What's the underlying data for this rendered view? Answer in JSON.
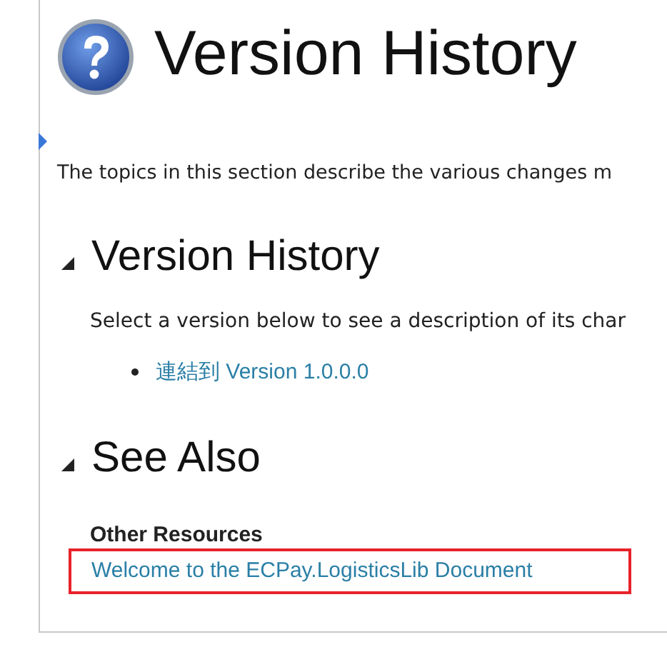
{
  "page": {
    "title": "Version History",
    "intro": "The topics in this section describe the various changes m",
    "sections": [
      {
        "heading": "Version History",
        "expanded": true,
        "text": "Select a version below to see a description of its char",
        "links": [
          "連結到 Version 1.0.0.0"
        ]
      },
      {
        "heading": "See Also",
        "expanded": true,
        "subheading": "Other Resources",
        "resource_link": {
          "text": "Welcome to the ECPay.LogisticsLib Document",
          "highlighted": true
        }
      }
    ]
  }
}
